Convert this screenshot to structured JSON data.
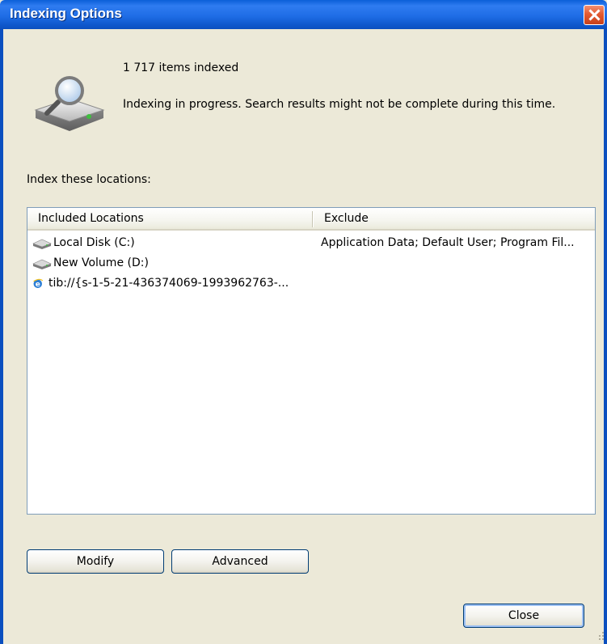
{
  "window": {
    "title": "Indexing Options",
    "close_icon": "close-x-icon"
  },
  "status": {
    "items_indexed": "1 717 items indexed",
    "message": "Indexing in progress. Search results might not be complete during this time.",
    "icon": "indexing-disk-magnifier-icon"
  },
  "locations": {
    "label": "Index these locations:",
    "columns": [
      "Included Locations",
      "Exclude"
    ],
    "rows": [
      {
        "name": "Local Disk (C:)",
        "exclude": "Application Data; Default User; Program Fil...",
        "icon": "drive-icon"
      },
      {
        "name": "New Volume (D:)",
        "exclude": "",
        "icon": "drive-icon"
      },
      {
        "name": "tib://{s-1-5-21-436374069-1993962763-...",
        "exclude": "",
        "icon": "internet-explorer-icon"
      }
    ]
  },
  "buttons": {
    "modify": "Modify",
    "advanced": "Advanced",
    "close": "Close"
  },
  "colors": {
    "titlebar": "#1f6de6",
    "dialog_bg": "#ece9d8",
    "close_red": "#e25b32"
  }
}
